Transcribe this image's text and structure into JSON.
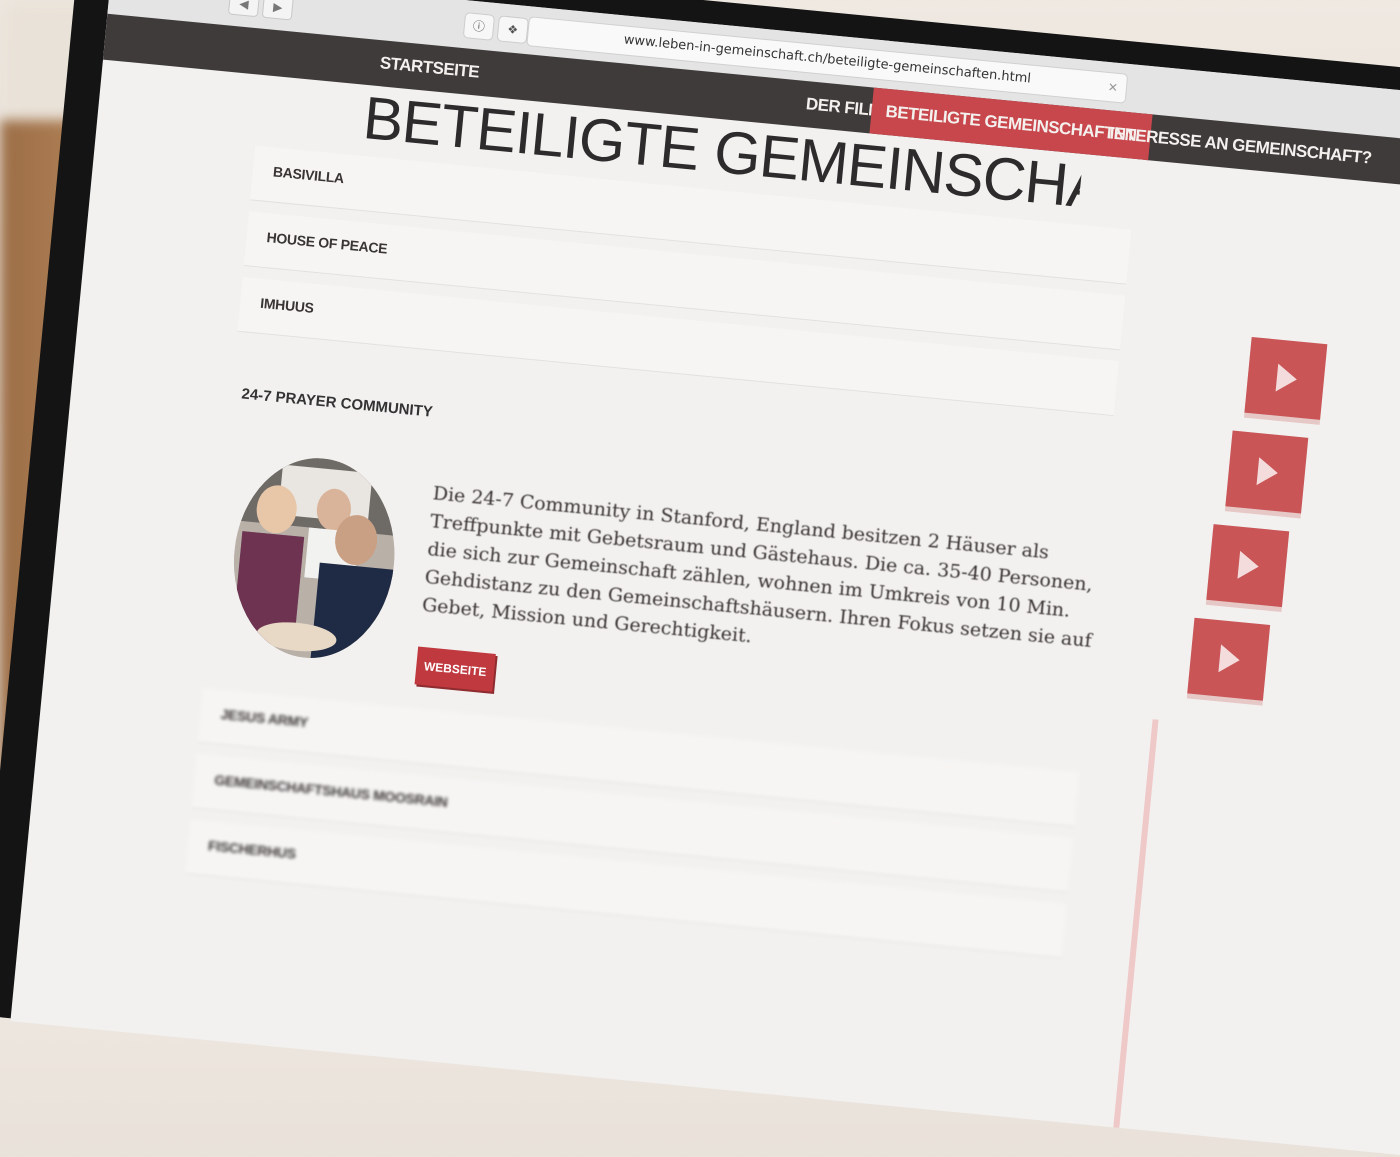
{
  "browser": {
    "url": "www.leben-in-gemeinschaft.ch/beteiligte-gemeinschaften.html",
    "back_icon": "back-arrow-icon",
    "forward_icon": "forward-arrow-icon",
    "info_icon": "info-icon",
    "extension_icon": "extension-icon"
  },
  "nav": {
    "home": "Startseite",
    "film": "Der Film",
    "communities": "Beteiligte Gemeinschaften",
    "interest": "Interesse an Gemeinschaft?"
  },
  "page": {
    "title": "Beteiligte Gemeinschaften"
  },
  "communities_top": [
    {
      "label": "Basivilla"
    },
    {
      "label": "House of Peace"
    },
    {
      "label": "Imhuus"
    }
  ],
  "selected": {
    "heading": "24-7 Prayer Community",
    "description": "Die 24-7 Community in Stanford, England besitzen 2 Häuser als Treffpunkte mit Gebetsraum und Gästehaus. Die ca. 35-40 Personen, die sich zur Gemeinschaft zählen, wohnen im Umkreis von 10 Min. Gehdistanz zu den Gemeinschaftshäusern. Ihren Fokus setzen sie auf Gebet, Mission und Gerechtigkeit.",
    "website_label": "Webseite"
  },
  "communities_bottom": [
    {
      "label": "Jesus Army"
    },
    {
      "label": "Gemeinschaftshaus Moosrain"
    },
    {
      "label": "Fischerhus"
    }
  ],
  "colors": {
    "accent": "#c7474c",
    "nav_bg": "#3f3b3a",
    "video_btn": "#c95557"
  }
}
